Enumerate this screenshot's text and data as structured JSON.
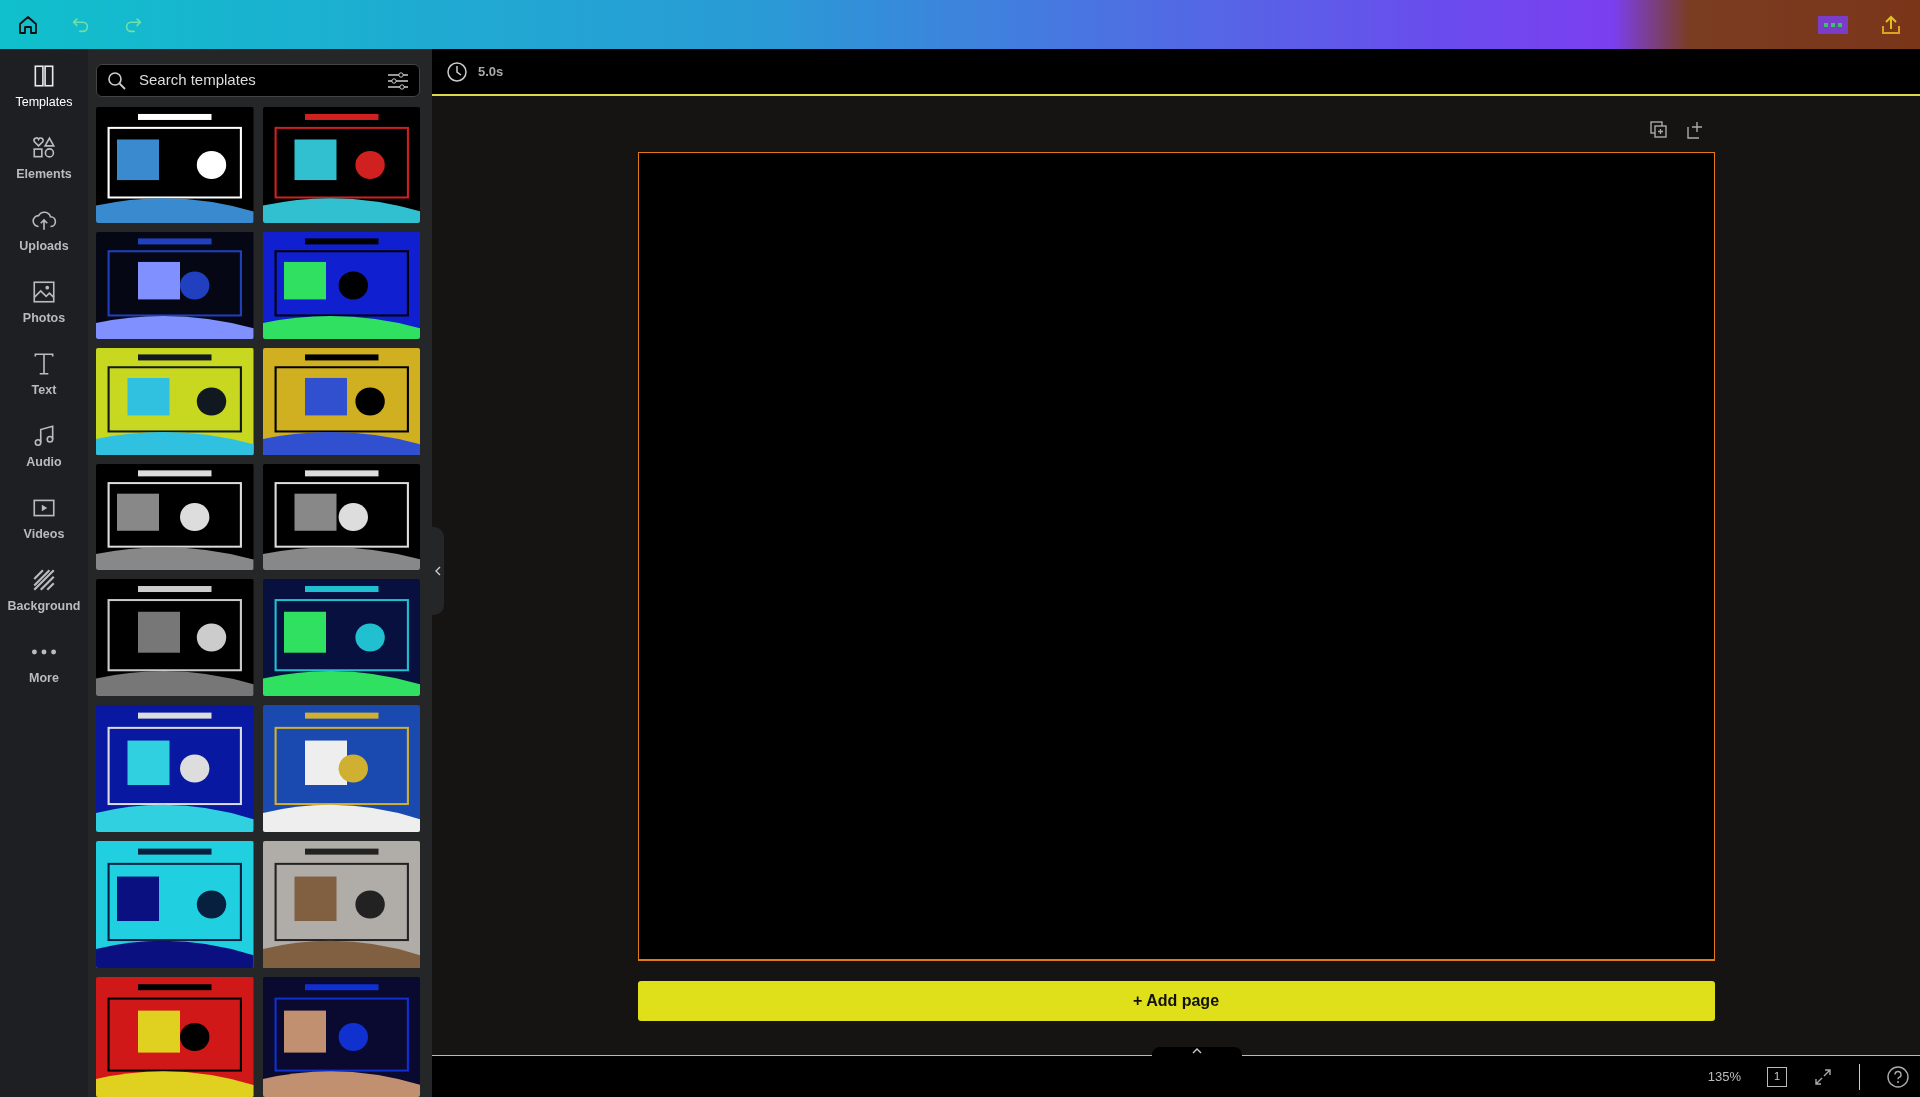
{
  "sidebar": {
    "items": [
      {
        "label": "Templates",
        "selected": true
      },
      {
        "label": "Elements",
        "selected": false
      },
      {
        "label": "Uploads",
        "selected": false
      },
      {
        "label": "Photos",
        "selected": false
      },
      {
        "label": "Text",
        "selected": false
      },
      {
        "label": "Audio",
        "selected": false
      },
      {
        "label": "Videos",
        "selected": false
      },
      {
        "label": "Background",
        "selected": false
      },
      {
        "label": "More",
        "selected": false
      }
    ]
  },
  "search": {
    "placeholder": "Search templates"
  },
  "editor": {
    "duration": "5.0s",
    "add_page": "+ Add page"
  },
  "status_bar": {
    "zoom": "135%",
    "page_count": "1"
  }
}
